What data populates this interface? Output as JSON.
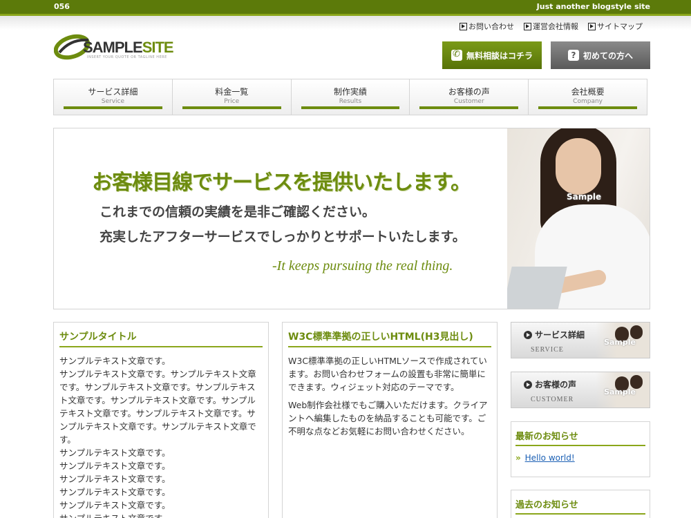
{
  "topbar": {
    "number": "056",
    "tagline": "Just another blogstyle site"
  },
  "util_links": [
    {
      "label": "お問い合わせ"
    },
    {
      "label": "運営会社情報"
    },
    {
      "label": "サイトマップ"
    }
  ],
  "logo": {
    "main": "SAMPLE",
    "accent": "SITE",
    "subtitle": "INSERT YOUR QUOTE OR TAGLINE HERE"
  },
  "header_buttons": {
    "consult": "無料相談はコチラ",
    "first_time": "初めての方へ"
  },
  "nav": [
    {
      "jp": "サービス詳細",
      "en": "Service"
    },
    {
      "jp": "料金一覧",
      "en": "Price"
    },
    {
      "jp": "制作実績",
      "en": "Results"
    },
    {
      "jp": "お客様の声",
      "en": "Customer"
    },
    {
      "jp": "会社概要",
      "en": "Company"
    }
  ],
  "hero": {
    "title": "お客様目線でサービスを提供いたします。",
    "line1": "これまでの信頼の実績を是非ご確認ください。",
    "line2": "充実したアフターサービスでしっかりとサポートいたします。",
    "english": "-It keeps pursuing the real thing.",
    "photo_label": "Sample"
  },
  "left_column": {
    "title": "サンプルタイトル",
    "paragraphs": [
      "サンプルテキスト文章です。",
      "サンプルテキスト文章です。サンプルテキスト文章です。サンプルテキスト文章です。サンプルテキスト文章です。サンプルテキスト文章です。サンプルテキスト文章です。サンプルテキスト文章です。サンプルテキスト文章です。サンプルテキスト文章です。",
      "サンプルテキスト文章です。",
      "サンプルテキスト文章です。",
      "サンプルテキスト文章です。",
      "サンプルテキスト文章です。",
      "サンプルテキスト文章です。",
      "サンプルテキスト文章です。"
    ]
  },
  "mid_column": {
    "title": "W3C標準準拠の正しいHTML(H3見出し)",
    "paragraphs": [
      "W3C標準準拠の正しいHTMLソースで作成されています。お問い合わせフォームの設置も非常に簡単にできます。ウィジェット対応のテーマです。",
      "Web制作会社様でもご購入いただけます。クライアントへ編集したものを納品することも可能です。ご不明な点などお気軽にお問い合わせください。"
    ]
  },
  "sidebar": {
    "banners": [
      {
        "jp": "サービス詳細",
        "en": "SERVICE",
        "photo_label": "Sample"
      },
      {
        "jp": "お客様の声",
        "en": "CUSTOMER",
        "photo_label": "Sample"
      }
    ],
    "news": {
      "title": "最新のお知らせ",
      "items": [
        "Hello world!"
      ]
    },
    "past": {
      "title": "過去のお知らせ"
    }
  },
  "colors": {
    "brand_green": "#6d8c0f",
    "topbar_green": "#5c7a0a",
    "accent_green": "#8aa61a",
    "link_blue": "#1a5fb4"
  }
}
